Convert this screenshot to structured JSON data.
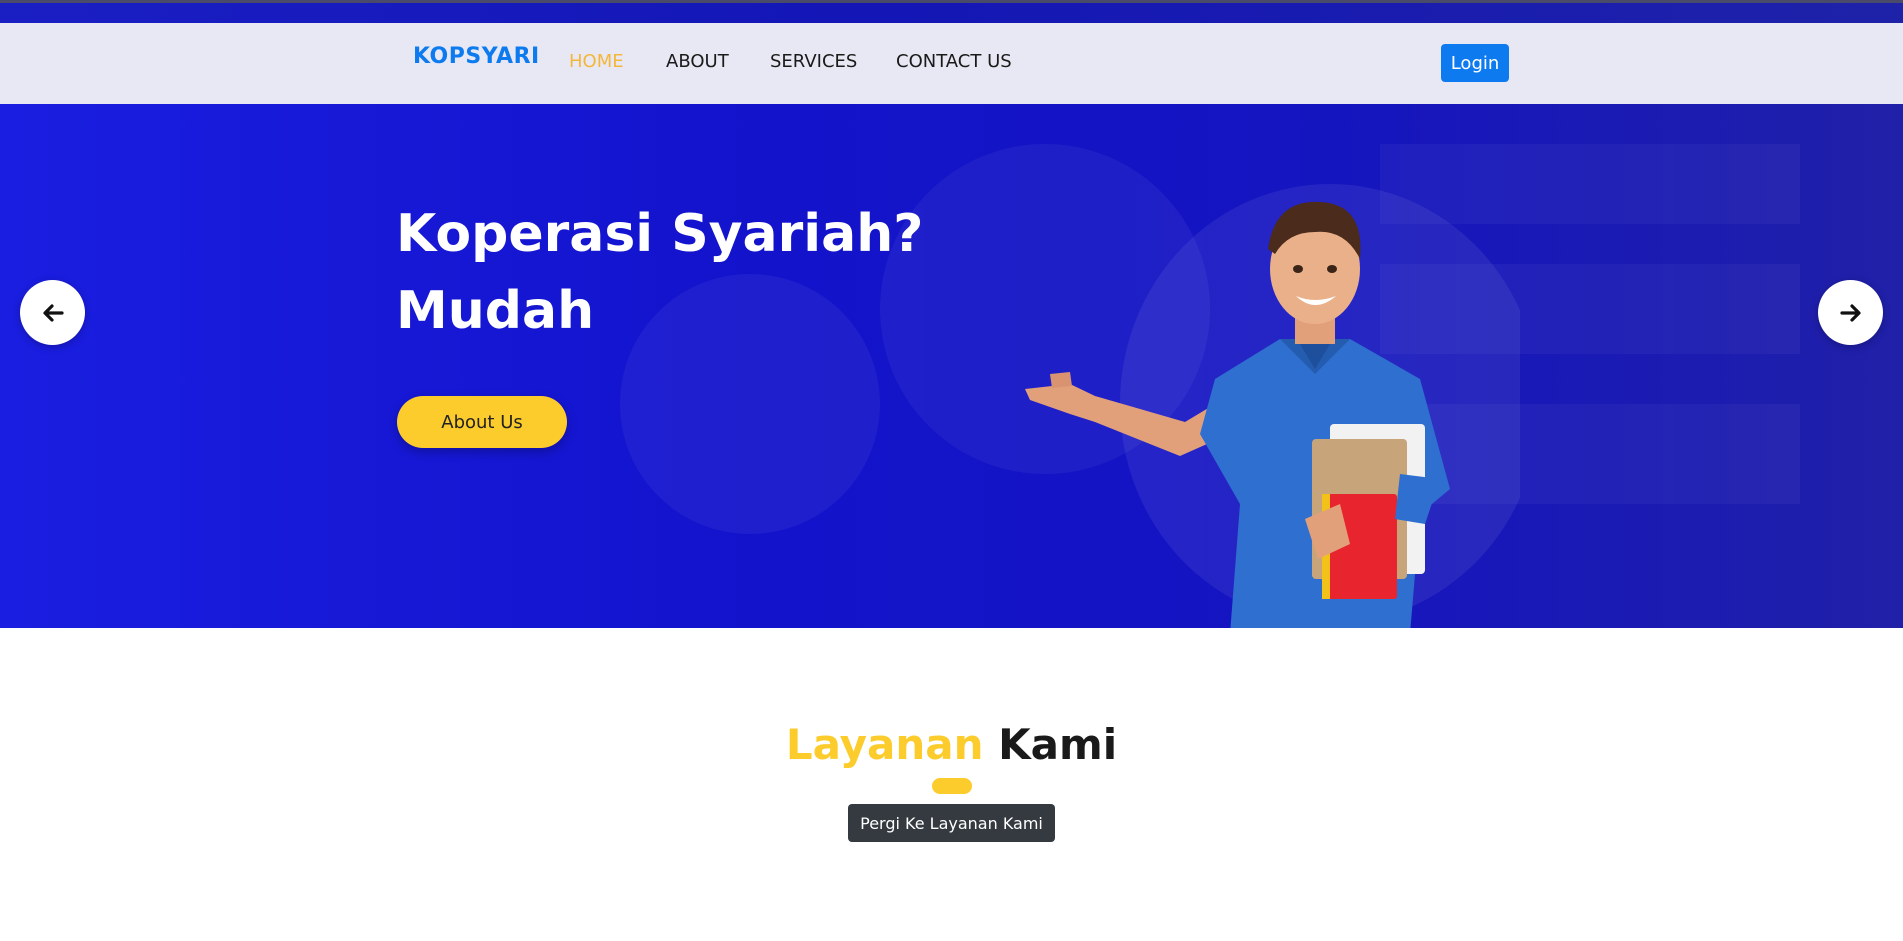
{
  "navbar": {
    "brand": "KOPSYARI",
    "links": [
      {
        "label": "HOME",
        "active": true
      },
      {
        "label": "ABOUT",
        "active": false
      },
      {
        "label": "SERVICES",
        "active": false
      },
      {
        "label": "CONTACT US",
        "active": false
      }
    ],
    "login_label": "Login"
  },
  "hero": {
    "title_line1": "Koperasi Syariah?",
    "title_line2": "Mudah",
    "cta_label": "About Us",
    "prev_icon": "arrow-left-icon",
    "next_icon": "arrow-right-icon"
  },
  "services": {
    "title_highlight": "Layanan",
    "title_rest": "Kami",
    "button_label": "Pergi Ke Layanan Kami"
  },
  "colors": {
    "brand_blue": "#0d7bef",
    "accent_yellow": "#fccc2c",
    "hero_blue": "#1414cc",
    "dark_button": "#343a40"
  }
}
